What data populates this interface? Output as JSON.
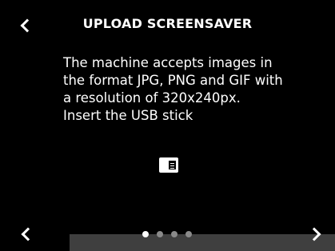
{
  "header": {
    "title": "UPLOAD SCREENSAVER",
    "back_icon": "chevron-left-icon"
  },
  "content": {
    "lines": [
      "The machine accepts images in",
      "the format JPG, PNG and GIF with",
      "a resolution of 320x240px.",
      "Insert the USB stick"
    ],
    "icon": "usb-stick-icon"
  },
  "pagination": {
    "total": 4,
    "active_index": 0,
    "prev_icon": "chevron-left-icon",
    "next_icon": "chevron-right-icon"
  },
  "colors": {
    "background": "#000000",
    "text": "#ffffff",
    "footer_bar": "#3f3f3f",
    "dot_active": "#ffffff",
    "dot_inactive": "#8a8a8a"
  }
}
